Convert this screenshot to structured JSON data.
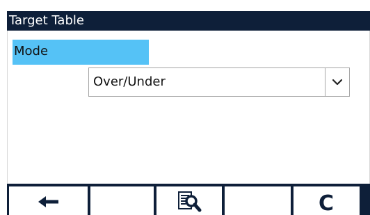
{
  "title_bar": {
    "title": "Target Table"
  },
  "form": {
    "mode_label": "Mode",
    "mode_value": "Over/Under",
    "dropdown_icon": "chevron-down-icon"
  },
  "softkeys": [
    {
      "name": "back",
      "icon": "arrow-left-icon"
    },
    {
      "name": "empty-1",
      "icon": ""
    },
    {
      "name": "view-table",
      "icon": "search-document-icon"
    },
    {
      "name": "empty-2",
      "icon": ""
    },
    {
      "name": "clear",
      "icon": "clear-c-icon",
      "glyph": "C"
    }
  ],
  "colors": {
    "title_bar_bg": "#0e1f39",
    "label_highlight": "#55c2f6"
  }
}
